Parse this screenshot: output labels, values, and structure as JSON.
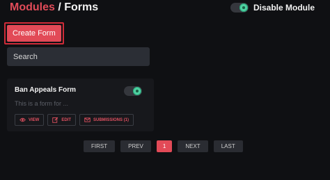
{
  "header": {
    "section": "Modules",
    "separator": "/",
    "title": "Forms"
  },
  "module_toggle": {
    "label": "Disable Module",
    "on": true
  },
  "create_button": {
    "label": "Create Form"
  },
  "search": {
    "placeholder": "Search"
  },
  "form_card": {
    "title": "Ban Appeals Form",
    "description": "This is a form for ...",
    "enabled": true,
    "actions": [
      {
        "label": "VIEW",
        "icon": "eye-icon"
      },
      {
        "label": "EDIT",
        "icon": "edit-icon"
      },
      {
        "label": "SUBMISSIONS (1)",
        "icon": "envelope-icon"
      }
    ]
  },
  "pagination": {
    "first": "FIRST",
    "prev": "PREV",
    "current": "1",
    "next": "NEXT",
    "last": "LAST"
  },
  "colors": {
    "accent": "#e24a57",
    "toggle_on": "#4fd1a1",
    "background": "#0f1013"
  }
}
